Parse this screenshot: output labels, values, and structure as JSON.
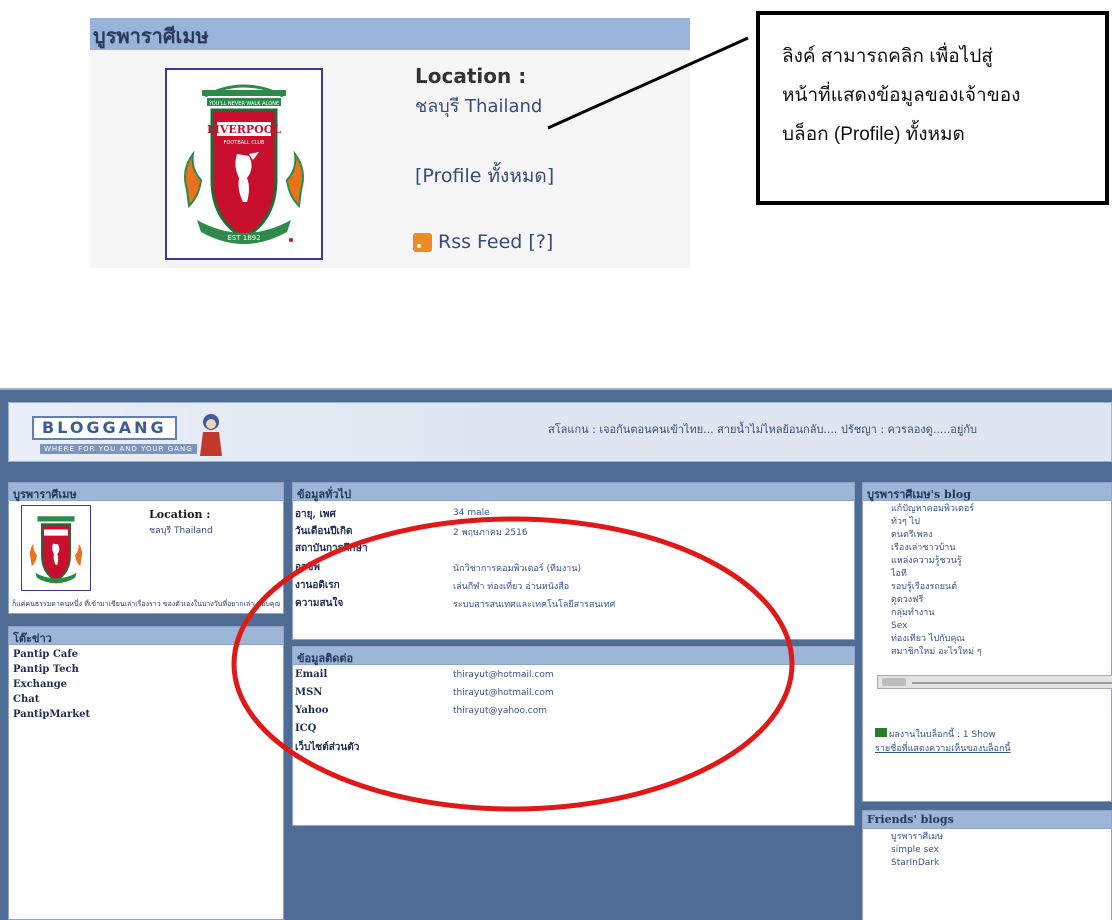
{
  "top": {
    "title": "บูรพาราศีเมษ",
    "location_label": "Location :",
    "location_value": "ชลบุรี Thailand",
    "profile_link": "[Profile ทั้งหมด]",
    "rss_link": "Rss Feed [?]"
  },
  "callout": {
    "line1": "ลิงค์ สามารถคลิก เพื่อไปสู่",
    "line2": "หน้าที่แสดงข้อมูลของเจ้าของ",
    "line3": "บล็อก (Profile) ทั้งหมด"
  },
  "screenshot": {
    "logo_text": "BLOGGANG",
    "logo_tagline": "WHERE FOR YOU AND YOUR GANG",
    "marquee": "สโลแกน : เจอกันตอนคนเข้าไทย... สายน้ำไม่ไหลย้อนกลับ.... ปรัชญา : ควรลองดู.....อยู่กับ",
    "left_profile": {
      "header": "บูรพาราศีเมษ",
      "location_label": "Location :",
      "location_value": "ชลบุรี Thailand",
      "description": "ก็แค่คนธรรมดาคนหนึ่ง ที่เข้ามาเขียนเล่าเรื่องราว ของตัวเองในบางวันที่อยากเล่า ขอบคุณที่แวะมาอ่าน"
    },
    "left_links": {
      "header": "โต๊ะข่าว",
      "items": [
        "Pantip Cafe",
        "Pantip Tech",
        "Exchange",
        "Chat",
        "PantipMarket"
      ]
    },
    "general": {
      "header": "ข้อมูลทั่วไป",
      "rows": [
        {
          "label": "อายุ, เพศ",
          "value": "34 male"
        },
        {
          "label": "วันเดือนปีเกิด",
          "value": "2 พฤษภาคม 2516"
        },
        {
          "label": "สถาบันการศึกษา",
          "value": ""
        },
        {
          "label": "อาชีพ",
          "value": "นักวิชาการคอมพิวเตอร์ (ทีมงาน)"
        },
        {
          "label": "งานอดิเรก",
          "value": "เล่นกีฬา ท่องเที่ยว อ่านหนังสือ"
        },
        {
          "label": "ความสนใจ",
          "value": "ระบบสารสนเทศและเทคโนโลยีสารสนเทศ"
        }
      ]
    },
    "contact": {
      "header": "ข้อมูลติดต่อ",
      "rows": [
        {
          "label": "Email",
          "value": "thirayut@hotmail.com"
        },
        {
          "label": "MSN",
          "value": "thirayut@hotmail.com"
        },
        {
          "label": "Yahoo",
          "value": "thirayut@yahoo.com"
        },
        {
          "label": "ICQ",
          "value": ""
        },
        {
          "label": "เว็บไซต์ส่วนตัว",
          "value": ""
        }
      ]
    },
    "blog": {
      "header": "บูรพาราศีเมษ's blog",
      "items": [
        "แก้ปัญหาคอมพิวเตอร์",
        "ทั่วๆ ไป",
        "ดนตรีเพลง",
        "เรื่องเล่าชาวบ้าน",
        "แหล่งความรู้ชวนรู้",
        "ไอที",
        "รอบรู้เรื่องรถยนต์",
        "ดูดวงฟรี",
        "กลุ่มทำงาน",
        "Sex",
        "ท่องเที่ยว ไปกับคุณ",
        "สมาชิกใหม่ อะไรใหม่ ๆ"
      ],
      "rating_text": "ผลงานในบล็อกนี้ : 1 Show",
      "rating_sub": "รายชื่อที่แสดงความเห็นของบล็อกนี้"
    },
    "friends": {
      "header": "Friends' blogs",
      "items": [
        "บูรพาราศีเมษ",
        "simple sex",
        "StarInDark"
      ]
    }
  }
}
